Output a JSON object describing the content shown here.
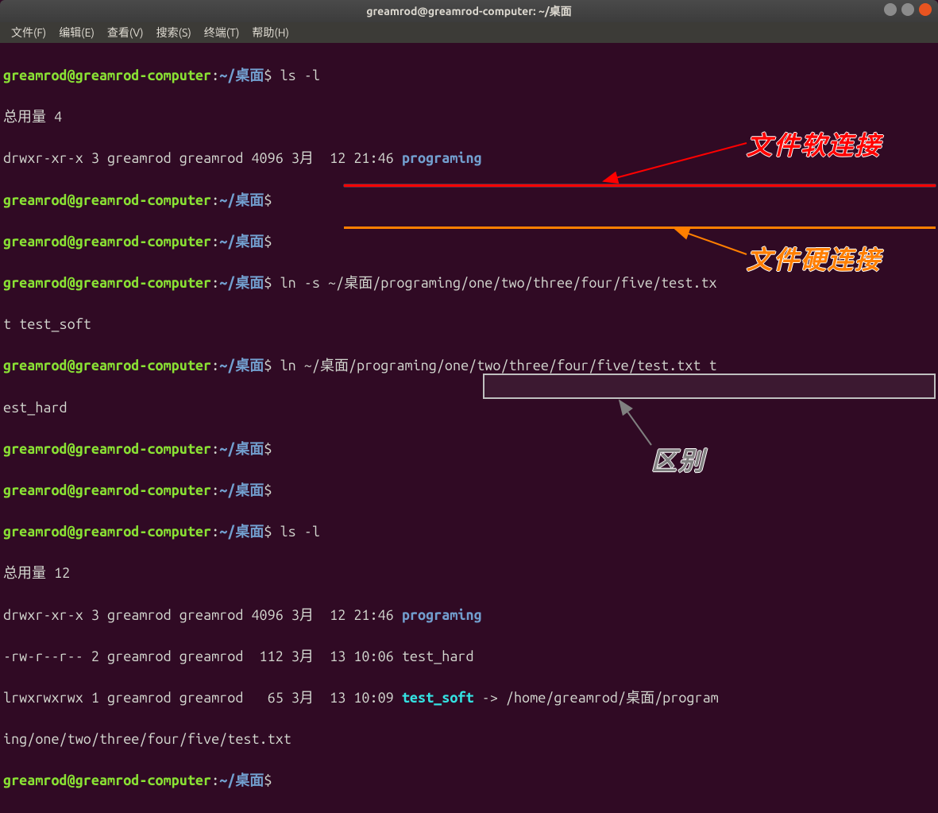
{
  "titlebar": {
    "title": "greamrod@greamrod-computer: ~/桌面"
  },
  "menubar": {
    "items": [
      "文件(F)",
      "编辑(E)",
      "查看(V)",
      "搜索(S)",
      "终端(T)",
      "帮助(H)"
    ]
  },
  "prompt": {
    "user_host": "greamrod@greamrod-computer",
    "colon": ":",
    "tilde": "~",
    "path": "/桌面",
    "dollar": "$"
  },
  "lines": {
    "cmd_ls1": " ls -l",
    "total1": "总用量 4",
    "entry1_perms": "drwxr-xr-x 3 greamrod greamrod 4096 3月  12 21:46 ",
    "entry1_name": "programing",
    "cmd_ln_soft_a": " ln -s ~/桌面/programing/one/two/three/four/five/test.tx",
    "cmd_ln_soft_b": "t test_soft",
    "cmd_ln_hard_a": " ln ~/桌面/programing/one/two/three/four/five/test.txt t",
    "cmd_ln_hard_b": "est_hard",
    "cmd_ls2": " ls -l",
    "total2": "总用量 12",
    "entry2_perms": "drwxr-xr-x 3 greamrod greamrod 4096 3月  12 21:46 ",
    "entry2_name": "programing",
    "entry3": "-rw-r--r-- 2 greamrod greamrod  112 3月  13 10:06 test_hard",
    "entry4_perms": "lrwxrwxrwx 1 greamrod greamrod   65 3月  13 10:09 ",
    "entry4_name": "test_soft",
    "entry4_arrow": " -> /home/greamrod/桌面/program",
    "entry4_cont": "ing/one/two/three/four/five/test.txt"
  },
  "annotations": {
    "soft_link": "文件软连接",
    "hard_link": "文件硬连接",
    "difference": "区别"
  }
}
